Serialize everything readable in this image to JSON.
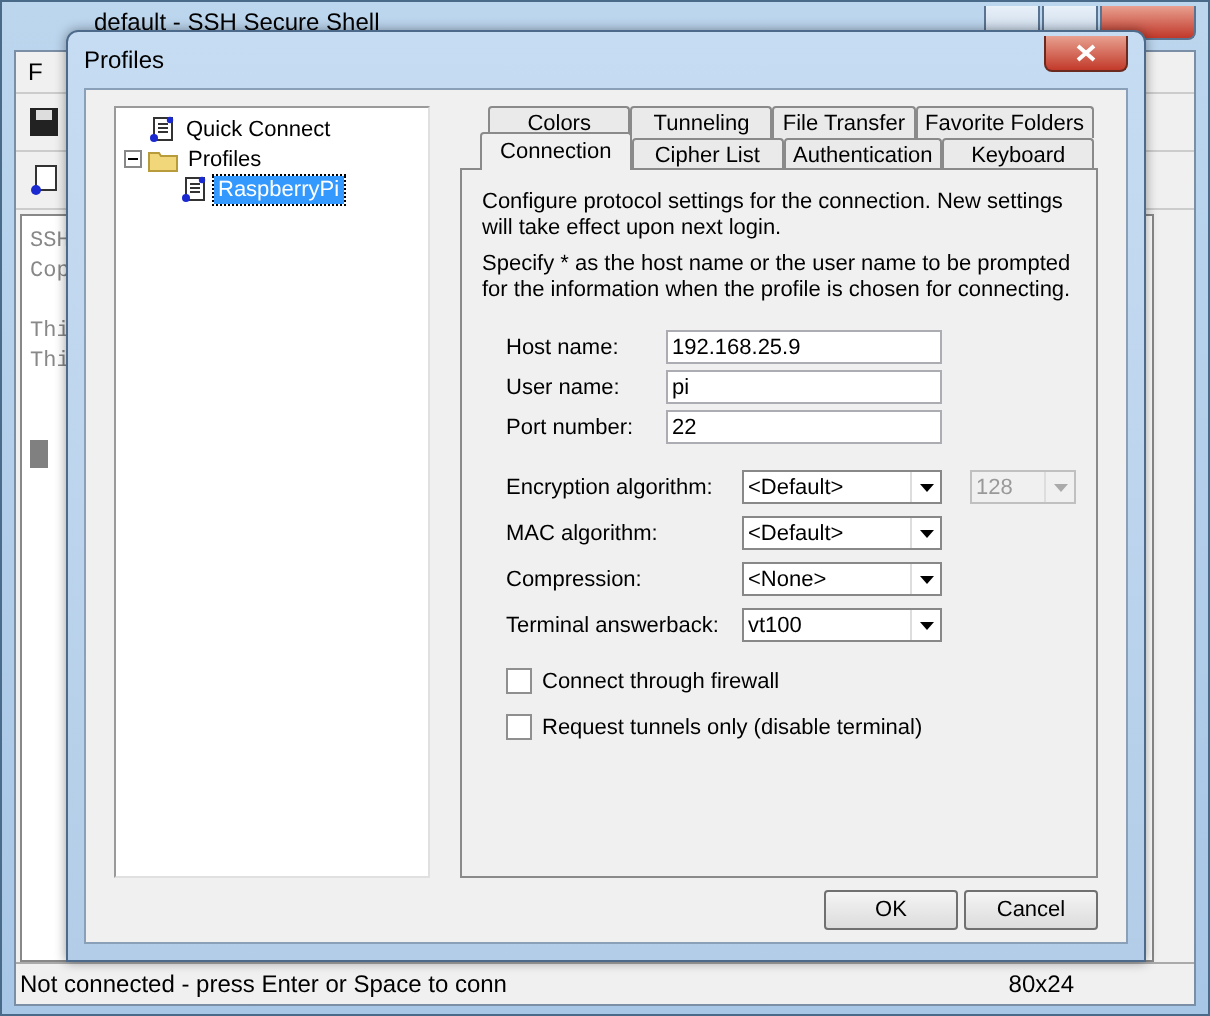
{
  "background_window": {
    "title": "default - SSH Secure Shell",
    "menu_label": "F",
    "terminal_paragraphs": [
      [
        "SSH",
        "Cop"
      ],
      [
        "Thi",
        "Thi"
      ]
    ],
    "status_text": "Not connected - press Enter or Space to conn",
    "status_size": "80x24"
  },
  "dialog": {
    "title": "Profiles",
    "tree": [
      {
        "label": "Quick Connect",
        "kind": "profile",
        "selected": false
      },
      {
        "label": "Profiles",
        "kind": "folder",
        "selected": false,
        "expanded": true,
        "children": [
          {
            "label": "RaspberryPi",
            "kind": "profile",
            "selected": true
          }
        ]
      }
    ],
    "tabs_back_row": [
      {
        "label": "Colors",
        "selected": false
      },
      {
        "label": "Tunneling",
        "selected": false
      },
      {
        "label": "File Transfer",
        "selected": false
      },
      {
        "label": "Favorite Folders",
        "selected": false
      }
    ],
    "tabs_front_row": [
      {
        "label": "Connection",
        "selected": true
      },
      {
        "label": "Cipher List",
        "selected": false
      },
      {
        "label": "Authentication",
        "selected": false
      },
      {
        "label": "Keyboard",
        "selected": false
      }
    ],
    "description": [
      "Configure protocol settings for the connection. New settings will take effect upon next login.",
      "Specify * as the host name or the user name to be prompted for the information when the profile is chosen for connecting."
    ],
    "text_fields": [
      {
        "label": "Host name:",
        "value": "192.168.25.9"
      },
      {
        "label": "User name:",
        "value": "pi"
      },
      {
        "label": "Port number:",
        "value": "22"
      }
    ],
    "select_fields": [
      {
        "label": "Encryption algorithm:",
        "value": "<Default>",
        "extra": {
          "value": "128",
          "disabled": true
        }
      },
      {
        "label": "MAC algorithm:",
        "value": "<Default>"
      },
      {
        "label": "Compression:",
        "value": "<None>"
      },
      {
        "label": "Terminal answerback:",
        "value": "vt100"
      }
    ],
    "checkboxes": [
      {
        "label": "Connect through firewall",
        "checked": false
      },
      {
        "label": "Request tunnels only (disable terminal)",
        "checked": false
      }
    ],
    "buttons": [
      "OK",
      "Cancel"
    ]
  }
}
